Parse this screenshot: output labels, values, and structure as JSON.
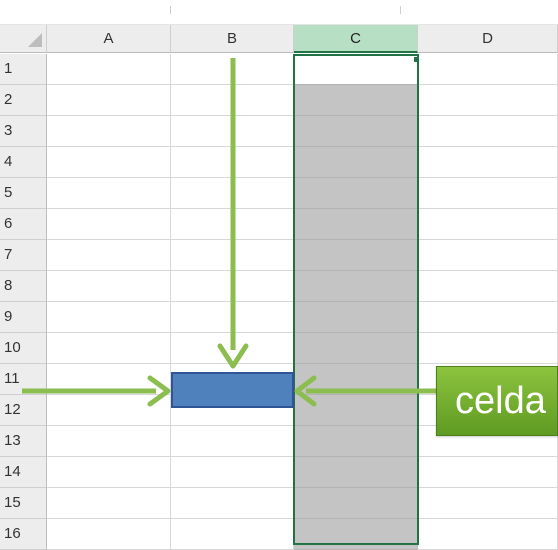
{
  "spreadsheet": {
    "columns": [
      "A",
      "B",
      "C",
      "D"
    ],
    "rows": [
      "1",
      "2",
      "3",
      "4",
      "5",
      "6",
      "7",
      "8",
      "9",
      "10",
      "11",
      "12",
      "13",
      "14",
      "15",
      "16"
    ],
    "selected_column": "C",
    "highlighted_cell": "B11"
  },
  "annotation": {
    "label": "celda"
  },
  "colors": {
    "arrow": "#8bbd4f",
    "label_fill": "#77b03a",
    "highlighted_cell_fill": "#4f81bd",
    "selected_column_header": "#b7dfc3",
    "selected_column_fill": "#c4c4c4",
    "selection_border": "#217346"
  }
}
